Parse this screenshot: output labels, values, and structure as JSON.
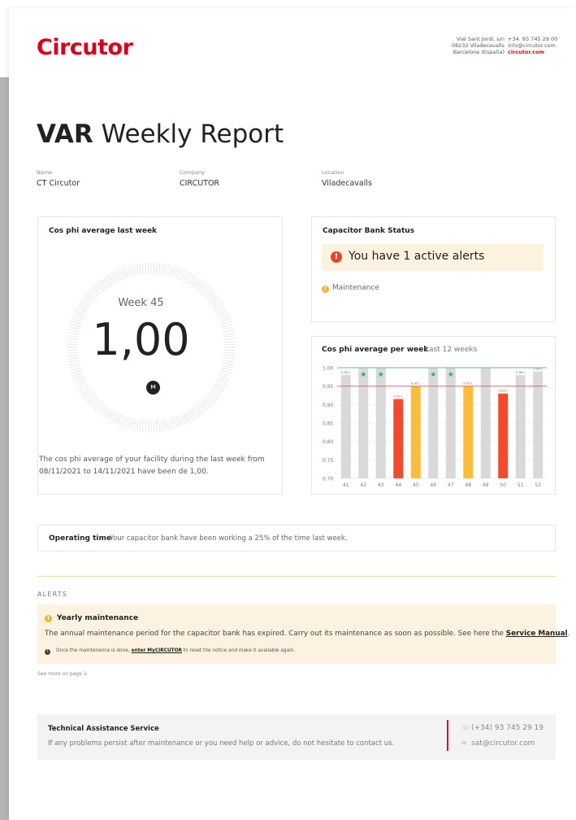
{
  "header": {
    "logo": "Circutor",
    "address_lines": [
      "Vial Sant Jordi, s/n",
      "08232 Viladecavalls",
      "Barcelona (España)"
    ],
    "contact_lines": [
      "+34. 93 745 29 00",
      "info@circutor.com",
      "circutor.com"
    ]
  },
  "report": {
    "title_bold": "VAR",
    "title_rest": " Weekly Report",
    "fields": [
      {
        "label": "Name",
        "value": "CT Circutor"
      },
      {
        "label": "Company",
        "value": "CIRCUTOR"
      },
      {
        "label": "Location",
        "value": "Viladecavalls"
      }
    ]
  },
  "cosphi_card": {
    "title": "Cos phi average last week",
    "week_label": "Week 45",
    "value": "1,00",
    "icon": "waveform-icon",
    "description": "The cos phi average of your facility during the last week from 08/11/2021 to 14/11/2021 have been de 1,00."
  },
  "status_card": {
    "title": "Capacitor Bank Status",
    "alert_icon": "!",
    "alert_text": "You have 1 active alerts",
    "item_icon": "!",
    "item": "Maintenance"
  },
  "weekly_card": {
    "title": "Cos phi average per week",
    "subtitle": "Last 12 weeks"
  },
  "chart_data": {
    "type": "bar",
    "categories": [
      "41",
      "42",
      "43",
      "44",
      "45",
      "46",
      "47",
      "48",
      "49",
      "50",
      "51",
      "52"
    ],
    "values": [
      0.98,
      1.0,
      1.0,
      0.915,
      0.95,
      1.0,
      1.0,
      0.95,
      1.0,
      0.93,
      0.98,
      0.99
    ],
    "labels": [
      "0,98 L",
      "",
      "",
      "0,93 L",
      "0,95 L",
      "",
      "",
      "0,95 L",
      "",
      "0,94 L",
      "0,98 L",
      "0,99 L"
    ],
    "stars": [
      false,
      true,
      true,
      false,
      false,
      true,
      true,
      false,
      false,
      false,
      false,
      false
    ],
    "bar_colors": [
      "#d9d9d9",
      "#d9d9d9",
      "#d9d9d9",
      "#f04a2f",
      "#fbbd3b",
      "#d9d9d9",
      "#d9d9d9",
      "#fbbd3b",
      "#d9d9d9",
      "#f04a2f",
      "#d9d9d9",
      "#d9d9d9"
    ],
    "star_color": "#1fae7e",
    "yticks": [
      "1,00",
      "0,95",
      "0,90",
      "0,85",
      "0,80",
      "0,75",
      "0,70"
    ],
    "ylim": [
      0.7,
      1.0
    ],
    "reference_lines": [
      {
        "value": 1.0,
        "color": "#2ab27b"
      },
      {
        "value": 0.95,
        "color": "#e85a5a"
      }
    ],
    "grid": true
  },
  "operating": {
    "title": "Operating time",
    "text": "Your capacitor bank have been working a 25% of the time last week."
  },
  "alerts": {
    "heading": "ALERTS",
    "icon": "!",
    "title": "Yearly maintenance",
    "text_before": "The annual maintenance period for the capacitor bank has expired. Carry out its maintenance as soon as possible. See here the ",
    "link": "Service Manual",
    "text_after": ".",
    "note_icon": "!",
    "note_before": "Once the maintenance is done, ",
    "note_link": "enter MyCIRCUTOR",
    "note_after": " to reset the notice and make it available again.",
    "see_more": "See more on page 2."
  },
  "tech": {
    "title": "Technical Assistance Service",
    "text": "If any problems persist after maintenance or you need help or advice, do not hesitate to contact us.",
    "phone": "(+34) 93 745 29 19",
    "email": "sat@circutor.com"
  },
  "colors": {
    "brand": "#d6001c",
    "alert_bg": "#fdf2e0",
    "alert_red": "#e8452c",
    "warning_yellow": "#f2b335"
  }
}
